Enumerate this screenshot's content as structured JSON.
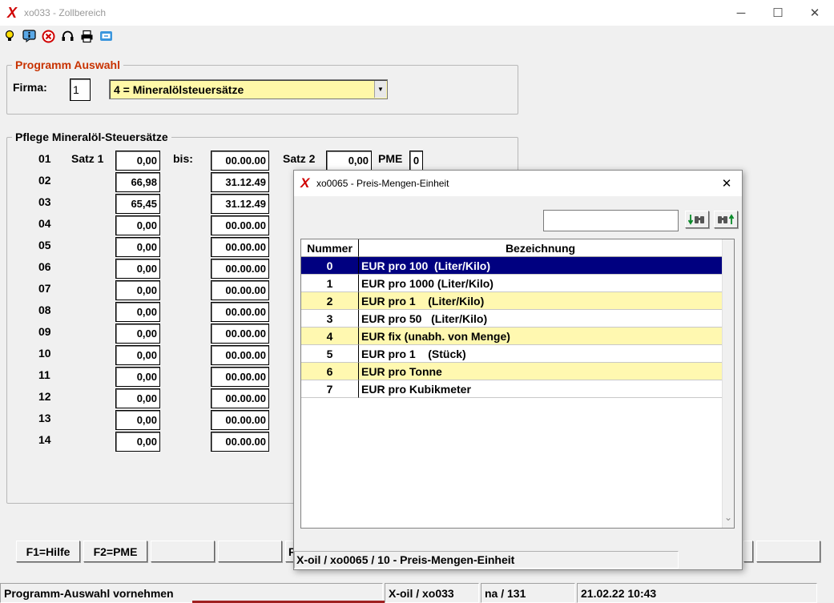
{
  "window": {
    "title": "xo033 - Zollbereich",
    "logo": "X",
    "min": "─",
    "max": "☐",
    "close": "✕"
  },
  "toolbar": {
    "icons": [
      "lightbulb-icon",
      "info-icon",
      "stop-icon",
      "headset-icon",
      "printer-icon",
      "screen-icon"
    ]
  },
  "programm": {
    "group_title": "Programm Auswahl",
    "firma_label": "Firma:",
    "firma_value": "1",
    "combo_value": "4 = Mineralölsteuersätze"
  },
  "pflege": {
    "group_title": "Pflege Mineralöl-Steuersätze",
    "satz1_label": "Satz 1",
    "bis_label": "bis:",
    "satz2_label": "Satz 2",
    "pme_label": "PME",
    "satz2_value": "0,00",
    "pme_value": "0",
    "rows": [
      {
        "nr": "01",
        "satz": "0,00",
        "bis": "00.00.00"
      },
      {
        "nr": "02",
        "satz": "66,98",
        "bis": "31.12.49"
      },
      {
        "nr": "03",
        "satz": "65,45",
        "bis": "31.12.49"
      },
      {
        "nr": "04",
        "satz": "0,00",
        "bis": "00.00.00"
      },
      {
        "nr": "05",
        "satz": "0,00",
        "bis": "00.00.00"
      },
      {
        "nr": "06",
        "satz": "0,00",
        "bis": "00.00.00"
      },
      {
        "nr": "07",
        "satz": "0,00",
        "bis": "00.00.00"
      },
      {
        "nr": "08",
        "satz": "0,00",
        "bis": "00.00.00"
      },
      {
        "nr": "09",
        "satz": "0,00",
        "bis": "00.00.00"
      },
      {
        "nr": "10",
        "satz": "0,00",
        "bis": "00.00.00"
      },
      {
        "nr": "11",
        "satz": "0,00",
        "bis": "00.00.00"
      },
      {
        "nr": "12",
        "satz": "0,00",
        "bis": "00.00.00"
      },
      {
        "nr": "13",
        "satz": "0,00",
        "bis": "00.00.00"
      },
      {
        "nr": "14",
        "satz": "0,00",
        "bis": "00.00.00"
      }
    ]
  },
  "buttons": {
    "f1": "F1=Hilfe",
    "f2": "F2=PME",
    "f3_partial": "F"
  },
  "status": {
    "message": "Programm-Auswahl vornehmen",
    "program": "X-oil / xo033",
    "user": "na / 131",
    "datetime": "21.02.22 10:43"
  },
  "dialog": {
    "title": "xo0065 - Preis-Mengen-Einheit",
    "logo": "X",
    "close": "✕",
    "search_value": "",
    "find_next_icon": "binoculars-down-icon",
    "find_prev_icon": "binoculars-up-icon",
    "col_nummer": "Nummer",
    "col_bezeichnung": "Bezeichnung",
    "rows": [
      {
        "nr": "0",
        "text": "EUR pro 100  (Liter/Kilo)"
      },
      {
        "nr": "1",
        "text": "EUR pro 1000 (Liter/Kilo)"
      },
      {
        "nr": "2",
        "text": "EUR pro 1    (Liter/Kilo)"
      },
      {
        "nr": "3",
        "text": "EUR pro 50   (Liter/Kilo)"
      },
      {
        "nr": "4",
        "text": "EUR fix (unabh. von Menge)"
      },
      {
        "nr": "5",
        "text": "EUR pro 1    (Stück)"
      },
      {
        "nr": "6",
        "text": "EUR pro Tonne"
      },
      {
        "nr": "7",
        "text": "EUR pro Kubikmeter"
      }
    ],
    "status": "X-oil / xo0065 / 10 - Preis-Mengen-Einheit",
    "scroll_down": "⌄"
  }
}
